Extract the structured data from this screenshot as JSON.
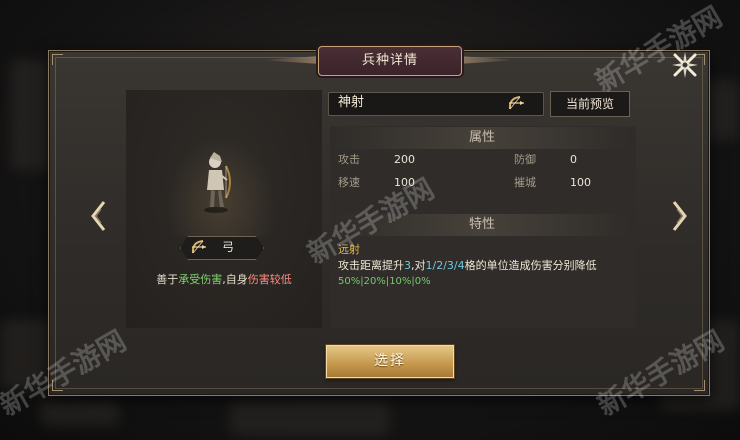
{
  "dialog": {
    "title": "兵种详情",
    "close_icon": "close-icon"
  },
  "unit": {
    "type_label": "弓",
    "type_icon": "bow-icon",
    "desc_prefix": "善于",
    "desc_strength": "承受伤害",
    "desc_mid": ",自身",
    "desc_weakness": "伤害较低"
  },
  "name_field": {
    "value": "神射",
    "icon": "bow-icon"
  },
  "preview_button": {
    "label": "当前预览"
  },
  "attributes": {
    "header": "属性",
    "rows": [
      {
        "label": "攻击",
        "value": "200"
      },
      {
        "label": "防御",
        "value": "0"
      },
      {
        "label": "移速",
        "value": "100"
      },
      {
        "label": "摧城",
        "value": "100"
      }
    ]
  },
  "traits": {
    "header": "特性",
    "name": "远射",
    "desc_part1": "攻击距离提升",
    "desc_range": "3",
    "desc_part2": ",对",
    "desc_grid": "1/2/3/4",
    "desc_part3": "格的单位造成伤害分别降低",
    "percentages": "50%|20%|10%|0%"
  },
  "select_button": {
    "label": "选择"
  },
  "watermark": "新华手游网",
  "colors": {
    "gold_button": "#c79b4f",
    "strength_green": "#7fd36f",
    "weakness_red": "#ff8c80",
    "trait_name": "#e3b84d",
    "highlight_cyan": "#6fc8e0"
  }
}
